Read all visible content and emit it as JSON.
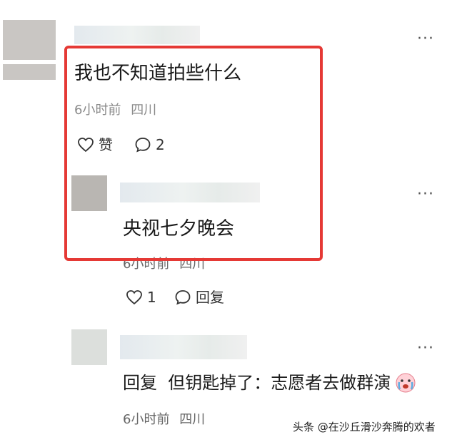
{
  "comment1": {
    "text": "我也不知道拍些什么",
    "time": "6小时前",
    "location": "四川",
    "like_label": "赞",
    "reply_count": "2",
    "more": "···"
  },
  "reply1": {
    "text": "央视七夕晚会",
    "time": "6小时前",
    "location": "四川",
    "like_count": "1",
    "reply_label": "回复",
    "more": "···"
  },
  "reply2": {
    "text": "回复  但钥匙掉了：志愿者去做群演",
    "time": "6小时前",
    "location": "四川",
    "more": "···"
  },
  "watermark": "头条 @在沙丘滑沙奔腾的欢者",
  "colors": {
    "highlight_border": "#e53935",
    "meta_text": "#8a8a8a"
  },
  "icons": [
    "heart-icon",
    "comment-bubble-icon",
    "crying-emoji-icon",
    "more-icon"
  ]
}
